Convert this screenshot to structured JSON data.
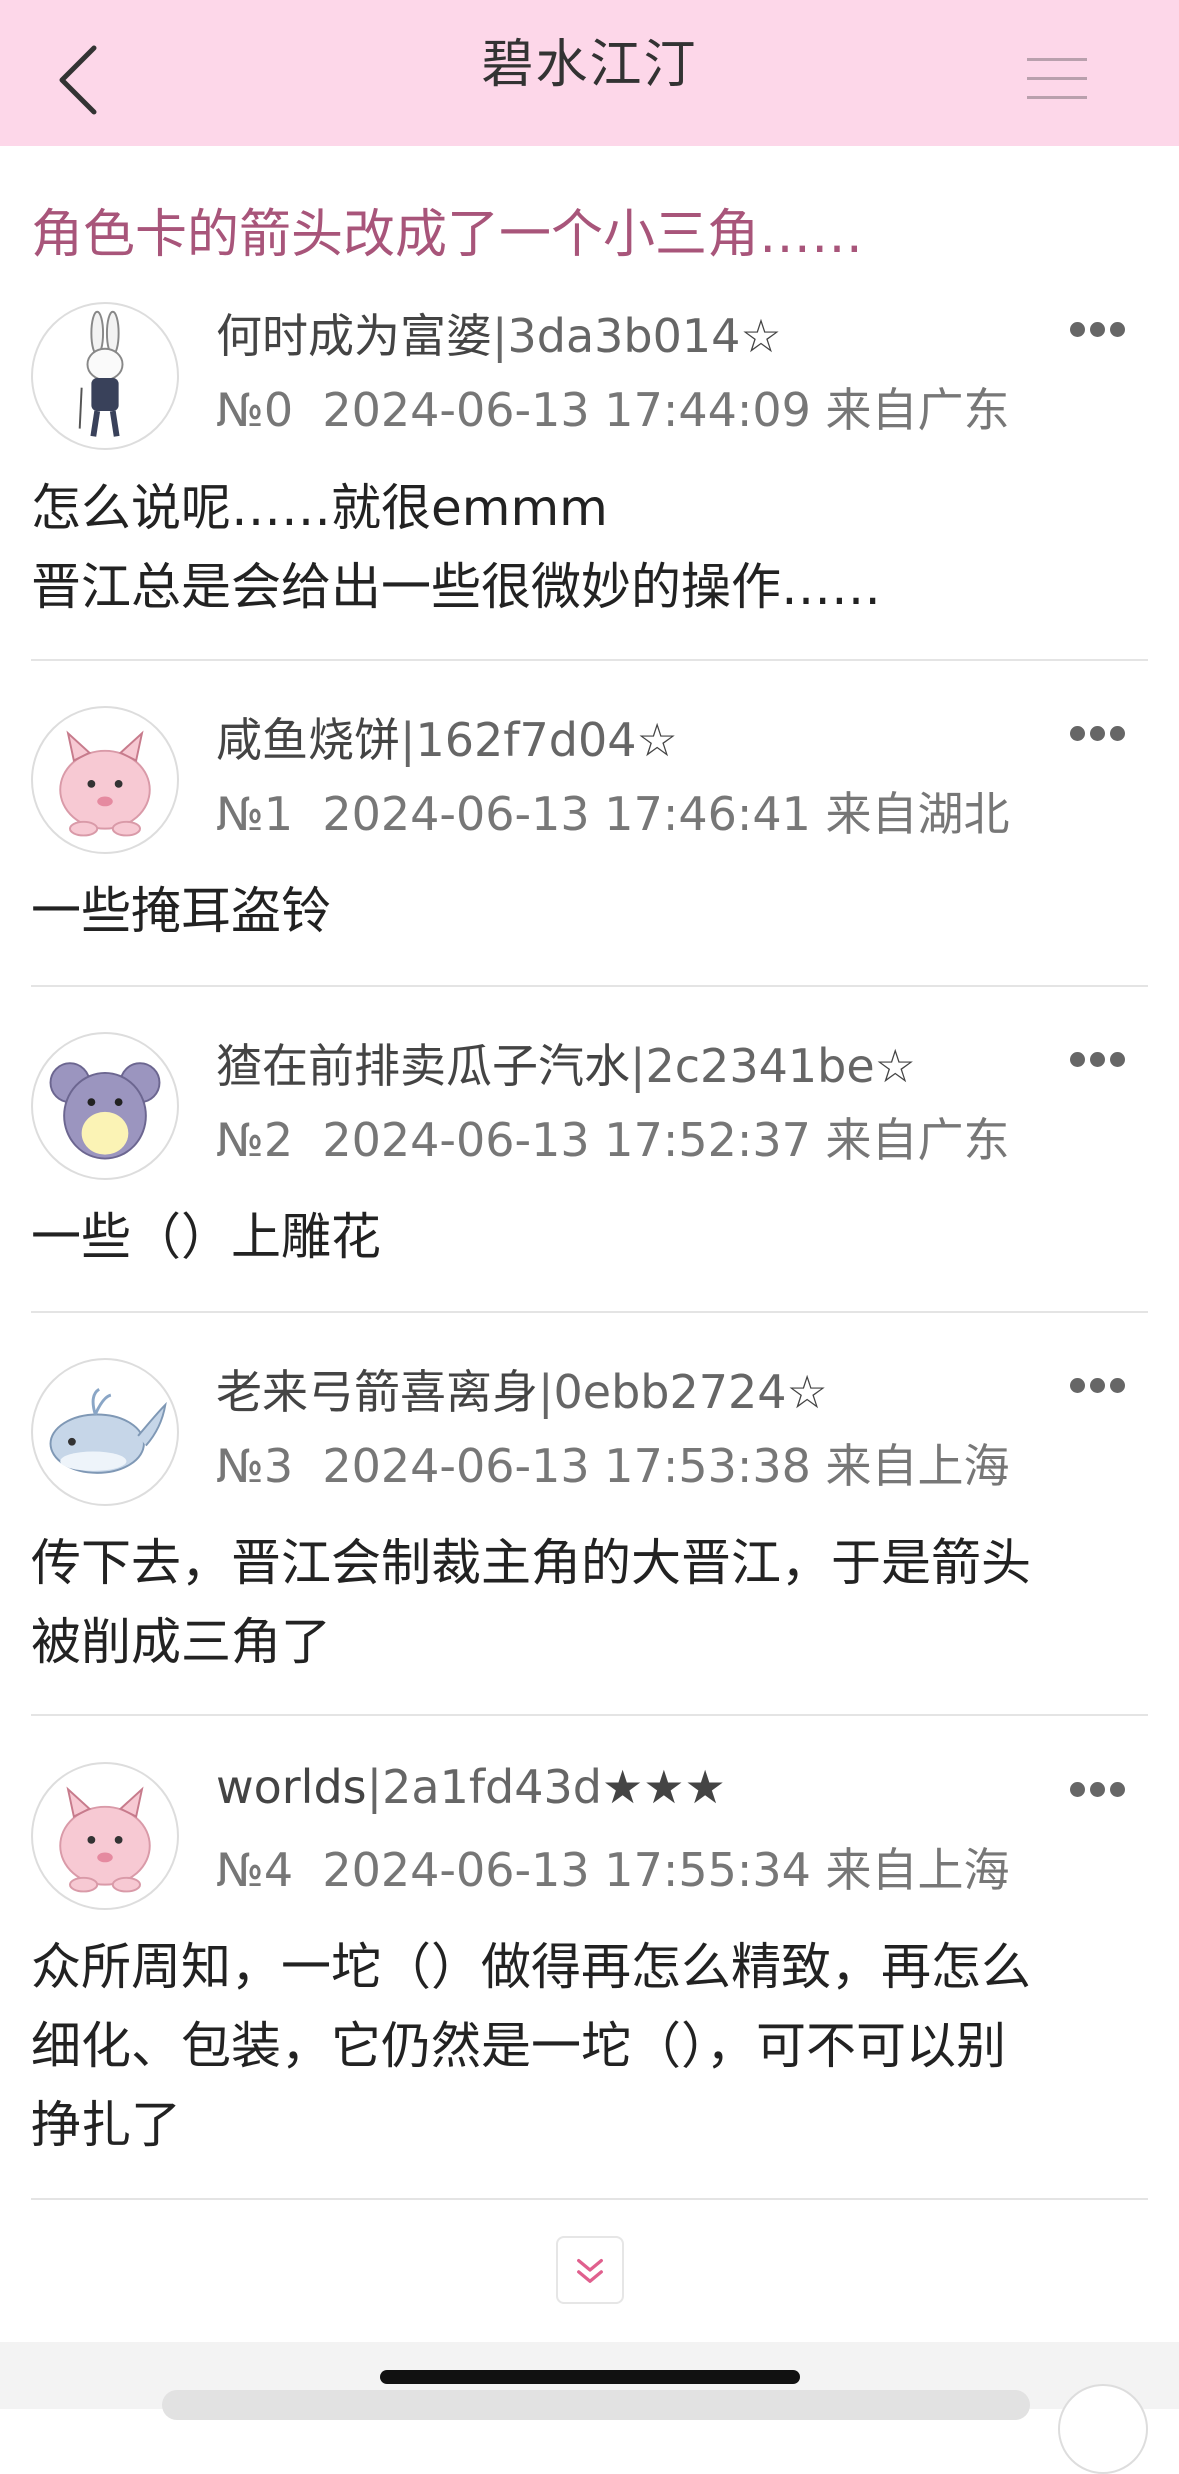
{
  "header": {
    "title": "碧水江汀"
  },
  "thread": {
    "title": "角色卡的箭头改成了一个小三角……"
  },
  "posts": [
    {
      "username": "何时成为富婆",
      "hash": "|3da3b014",
      "stars": "☆",
      "floor": "№0",
      "datetime": "2024-06-13 17:44:09",
      "location": "来自广东",
      "lines": [
        "怎么说呢……就很emmm",
        "晋江总是会给出一些很微妙的操作……"
      ],
      "avatar_icon": "rabbit-avatar-icon"
    },
    {
      "username": "咸鱼烧饼",
      "hash": "|162f7d04",
      "stars": "☆",
      "floor": "№1",
      "datetime": "2024-06-13 17:46:41",
      "location": "来自湖北",
      "lines": [
        "一些掩耳盗铃"
      ],
      "avatar_icon": "pink-pokemon-avatar-icon"
    },
    {
      "username": "猹在前排卖瓜子汽水",
      "hash": "|2c2341be",
      "stars": "☆",
      "floor": "№2",
      "datetime": "2024-06-13 17:52:37",
      "location": "来自广东",
      "lines": [
        "一些（）上雕花"
      ],
      "avatar_icon": "mouse-avatar-icon"
    },
    {
      "username": "老来弓箭喜离身",
      "hash": "|0ebb2724",
      "stars": "☆",
      "floor": "№3",
      "datetime": "2024-06-13 17:53:38",
      "location": "来自上海",
      "lines": [
        "传下去，晋江会制裁主角的大晋江，于是箭头",
        "被削成三角了"
      ],
      "avatar_icon": "whale-avatar-icon"
    },
    {
      "username": "worlds",
      "hash": "|2a1fd43d",
      "stars": "★★★",
      "floor": "№4",
      "datetime": "2024-06-13 17:55:34",
      "location": "来自上海",
      "lines": [
        "众所周知，一坨（）做得再怎么精致，再怎么",
        "细化、包装，它仍然是一坨（），可不可以别",
        "挣扎了"
      ],
      "avatar_icon": "pink-pokemon-avatar-icon"
    }
  ],
  "colors": {
    "header_bg": "#fdd7e9",
    "thread_title": "#a8557a",
    "load_more_arrow": "#e0608e"
  }
}
